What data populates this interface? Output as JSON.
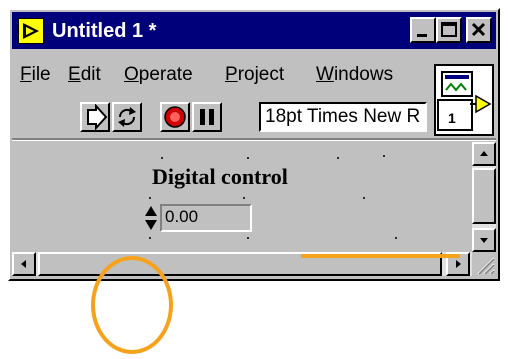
{
  "window": {
    "title": "Untitled 1 *",
    "icon": "labview-vi-icon",
    "controls": [
      "minimize-icon",
      "maximize-icon",
      "close-icon"
    ]
  },
  "menubar": {
    "items": [
      "File",
      "Edit",
      "Operate",
      "Project",
      "Windows"
    ]
  },
  "toolbar": {
    "buttons": [
      "run-arrow-icon",
      "run-continuously-icon",
      "abort-icon",
      "pause-icon"
    ],
    "font_value": "18pt Times New R"
  },
  "connector": {
    "label": "1"
  },
  "front_panel": {
    "control_label": "Digital control",
    "control_value": "0.00"
  },
  "colors": {
    "titlebar": "#00007b",
    "annotation": "#f7a21b"
  }
}
